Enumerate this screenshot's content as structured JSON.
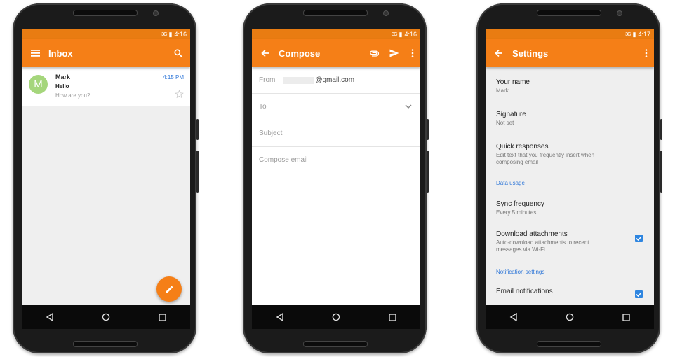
{
  "phones": {
    "inbox": {
      "status_time": "4:16",
      "status_signal": "3G",
      "title": "Inbox",
      "message": {
        "avatar_letter": "M",
        "from": "Mark",
        "subject": "Hello",
        "snippet": "How are you?",
        "time": "4:15 PM"
      }
    },
    "compose": {
      "status_time": "4:16",
      "status_signal": "3G",
      "title": "Compose",
      "from_label": "From",
      "from_value": "@gmail.com",
      "to_label": "To",
      "subject_placeholder": "Subject",
      "body_placeholder": "Compose email"
    },
    "settings": {
      "status_time": "4:17",
      "status_signal": "3G",
      "title": "Settings",
      "your_name_title": "Your name",
      "your_name_value": "Mark",
      "signature_title": "Signature",
      "signature_value": "Not set",
      "quick_responses_title": "Quick responses",
      "quick_responses_desc": "Edit text that you frequently insert when composing email",
      "data_usage_header": "Data usage",
      "sync_frequency_title": "Sync frequency",
      "sync_frequency_value": "Every 5 minutes",
      "download_attachments_title": "Download attachments",
      "download_attachments_desc": "Auto-download attachments to recent messages via Wi-Fi",
      "download_attachments_checked": true,
      "notification_header": "Notification settings",
      "email_notifications_title": "Email notifications",
      "email_notifications_checked": true
    }
  },
  "icons": {
    "menu": "menu-icon",
    "search": "search-icon",
    "back": "back-arrow-icon",
    "attach": "attachment-icon",
    "send": "send-icon",
    "overflow": "more-vert-icon",
    "star": "star-outline-icon",
    "edit": "pencil-icon",
    "nav_back": "nav-back-icon",
    "nav_home": "nav-home-icon",
    "nav_recents": "nav-recents-icon"
  },
  "colors": {
    "accent": "#f57f17",
    "status_bar": "#e97c12",
    "link_blue": "#2f77d8",
    "avatar_green": "#a5d67c"
  }
}
